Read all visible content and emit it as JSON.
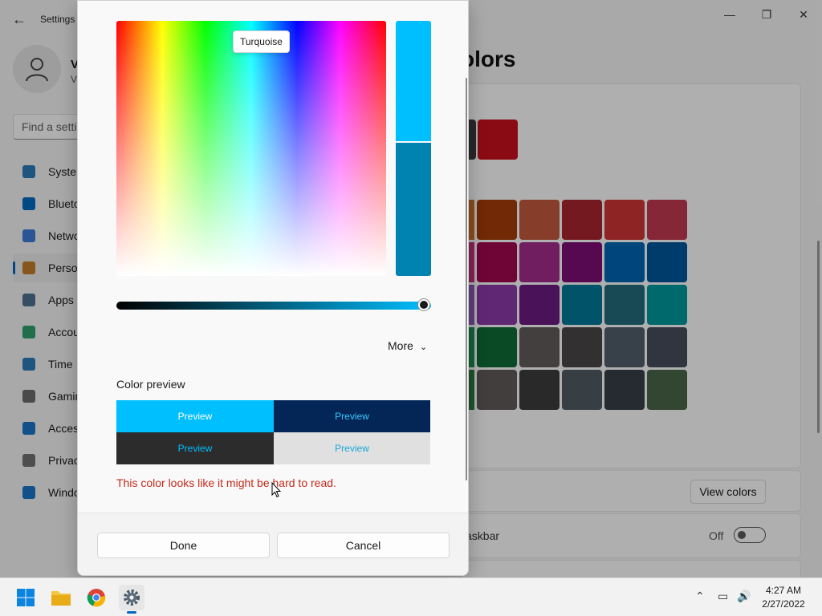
{
  "settings": {
    "app_title": "Settings",
    "profile_name": "V",
    "profile_sub": "V",
    "search_placeholder": "Find a setti",
    "nav": [
      {
        "label": "System",
        "icon": "system-icon",
        "color": "#2a7ab8"
      },
      {
        "label": "Blueto",
        "icon": "bluetooth-icon",
        "color": "#0067c0"
      },
      {
        "label": "Netwo",
        "icon": "network-icon",
        "color": "#3f7ad6"
      },
      {
        "label": "Perso",
        "icon": "personalization-icon",
        "color": "#c27c2a"
      },
      {
        "label": "Apps",
        "icon": "apps-icon",
        "color": "#4f6f8f"
      },
      {
        "label": "Accou",
        "icon": "accounts-icon",
        "color": "#2f9e6a"
      },
      {
        "label": "Time",
        "icon": "time-language-icon",
        "color": "#2a7ab8"
      },
      {
        "label": "Gamin",
        "icon": "gaming-icon",
        "color": "#6a6a6a"
      },
      {
        "label": "Acces",
        "icon": "accessibility-icon",
        "color": "#1a73c7"
      },
      {
        "label": "Privac",
        "icon": "privacy-icon",
        "color": "#707070"
      },
      {
        "label": "Windo",
        "icon": "windows-update-icon",
        "color": "#1a73c7"
      }
    ],
    "page_heading": "olors",
    "recent_colors": [
      "#3a3a3a",
      "#c8101e"
    ],
    "windows_colors_lead": [
      "#c86e2a",
      "#c0307a",
      "#8a58b8",
      "#1a8a50",
      "#2a7a3a"
    ],
    "windows_colors": [
      "#a33b0a",
      "#c0593e",
      "#a82530",
      "#cd3434",
      "#c13850",
      "#a0084f",
      "#a12c8a",
      "#7b0e73",
      "#0063b1",
      "#00569a",
      "#8a3aa6",
      "#6a1b80",
      "#007895",
      "#236b7a",
      "#00979a",
      "#0f6b35",
      "#625b5b",
      "#484645",
      "#515c6b",
      "#464c5c",
      "#5d5a58",
      "#3c3c3c",
      "#4f5962",
      "#353e45",
      "#4a6548"
    ],
    "view_colors_label": "View colors",
    "taskbar_row_label": "askbar",
    "toggle_state": "Off"
  },
  "dialog": {
    "spectrum_tooltip": "Turquoise",
    "new_color": "#00bfff",
    "old_color": "#0083b0",
    "value_fraction": 0.976,
    "more_label": "More",
    "color_preview_label": "Color preview",
    "preview_text": "Preview",
    "preview_cells": [
      {
        "bg": "#00bfff",
        "fg": "#ffffff"
      },
      {
        "bg": "#032657",
        "fg": "#39c7ff"
      },
      {
        "bg": "#2c2c2c",
        "fg": "#00bfff"
      },
      {
        "bg": "#e0e0e0",
        "fg": "#1aa8d8"
      }
    ],
    "warning": "This color looks like it might be hard to read.",
    "warning_color": "#c42b1c",
    "done_label": "Done",
    "cancel_label": "Cancel"
  },
  "taskbar": {
    "time": "4:27 AM",
    "date": "2/27/2022",
    "accent": "#0067c0"
  }
}
